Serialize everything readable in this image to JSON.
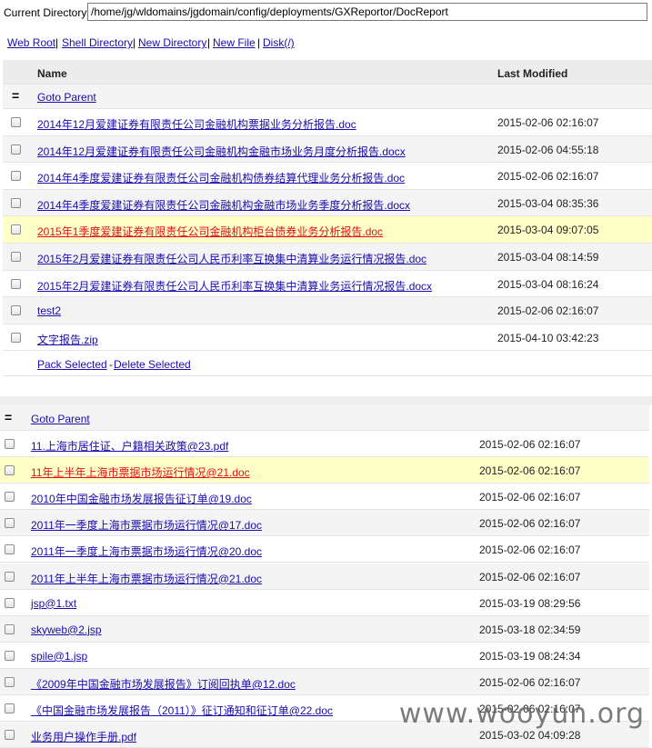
{
  "path_bar": {
    "label": "Current Directory",
    "value": "/home/jg/wldomains/jgdomain/config/deployments/GXReportor/DocReport"
  },
  "nav": [
    {
      "label": "Web Root"
    },
    {
      "label": "Shell Directory"
    },
    {
      "label": "New Directory"
    },
    {
      "label": "New File"
    },
    {
      "label": "Disk(/)"
    }
  ],
  "table1": {
    "columns": {
      "name": "Name",
      "modified": "Last Modified"
    },
    "goto_parent": "Goto Parent",
    "rows": [
      {
        "name": "2014年12月爱建证券有限责任公司金融机构票据业务分析报告.doc",
        "modified": "2015-02-06 02:16:07"
      },
      {
        "name": "2014年12月爱建证券有限责任公司金融机构金融市场业务月度分析报告.docx",
        "modified": "2015-02-06 04:55:18"
      },
      {
        "name": "2014年4季度爱建证券有限责任公司金融机构债券结算代理业务分析报告.doc",
        "modified": "2015-02-06 02:16:07"
      },
      {
        "name": "2014年4季度爱建证券有限责任公司金融机构金融市场业务季度分析报告.docx",
        "modified": "2015-03-04 08:35:36"
      },
      {
        "name": "2015年1季度爱建证券有限责任公司金融机构柜台债券业务分析报告.doc",
        "modified": "2015-03-04 09:07:05",
        "highlight": true
      },
      {
        "name": "2015年2月爱建证券有限责任公司人民币利率互换集中清算业务运行情况报告.doc",
        "modified": "2015-03-04 08:14:59"
      },
      {
        "name": "2015年2月爱建证券有限责任公司人民币利率互换集中清算业务运行情况报告.docx",
        "modified": "2015-03-04 08:16:24"
      },
      {
        "name": "test2",
        "modified": "2015-02-06 02:16:07"
      },
      {
        "name": "文字报告.zip",
        "modified": "2015-04-10 03:42:23"
      }
    ],
    "actions": {
      "pack": "Pack Selected",
      "sep": "-",
      "delete": "Delete Selected"
    }
  },
  "table2": {
    "goto_parent": "Goto Parent",
    "rows": [
      {
        "name": "11.上海市居住证、户籍相关政策@23.pdf",
        "modified": "2015-02-06 02:16:07"
      },
      {
        "name": "11年上半年上海市票据市场运行情况@21.doc",
        "modified": "2015-02-06 02:16:07",
        "highlight": true
      },
      {
        "name": "2010年中国金融市场发展报告征订单@19.doc",
        "modified": "2015-02-06 02:16:07"
      },
      {
        "name": "2011年一季度上海市票据市场运行情况@17.doc",
        "modified": "2015-02-06 02:16:07"
      },
      {
        "name": "2011年一季度上海市票据市场运行情况@20.doc",
        "modified": "2015-02-06 02:16:07"
      },
      {
        "name": "2011年上半年上海市票据市场运行情况@21.doc",
        "modified": "2015-02-06 02:16:07"
      },
      {
        "name": "jsp@1.txt",
        "modified": "2015-03-19 08:29:56"
      },
      {
        "name": "skyweb@2.jsp",
        "modified": "2015-03-18 02:34:59"
      },
      {
        "name": "spile@1.jsp",
        "modified": "2015-03-19 08:24:34"
      },
      {
        "name": "《2009年中国金融市场发展报告》订阅回执单@12.doc",
        "modified": "2015-02-06 02:16:07"
      },
      {
        "name": "《中国金融市场发展报告（2011）》征订通知和征订单@22.doc",
        "modified": "2015-02-06 02:16:07"
      },
      {
        "name": "业务用户操作手册.pdf",
        "modified": "2015-03-02 04:09:28"
      }
    ]
  },
  "watermark": "www.wooyun.org"
}
